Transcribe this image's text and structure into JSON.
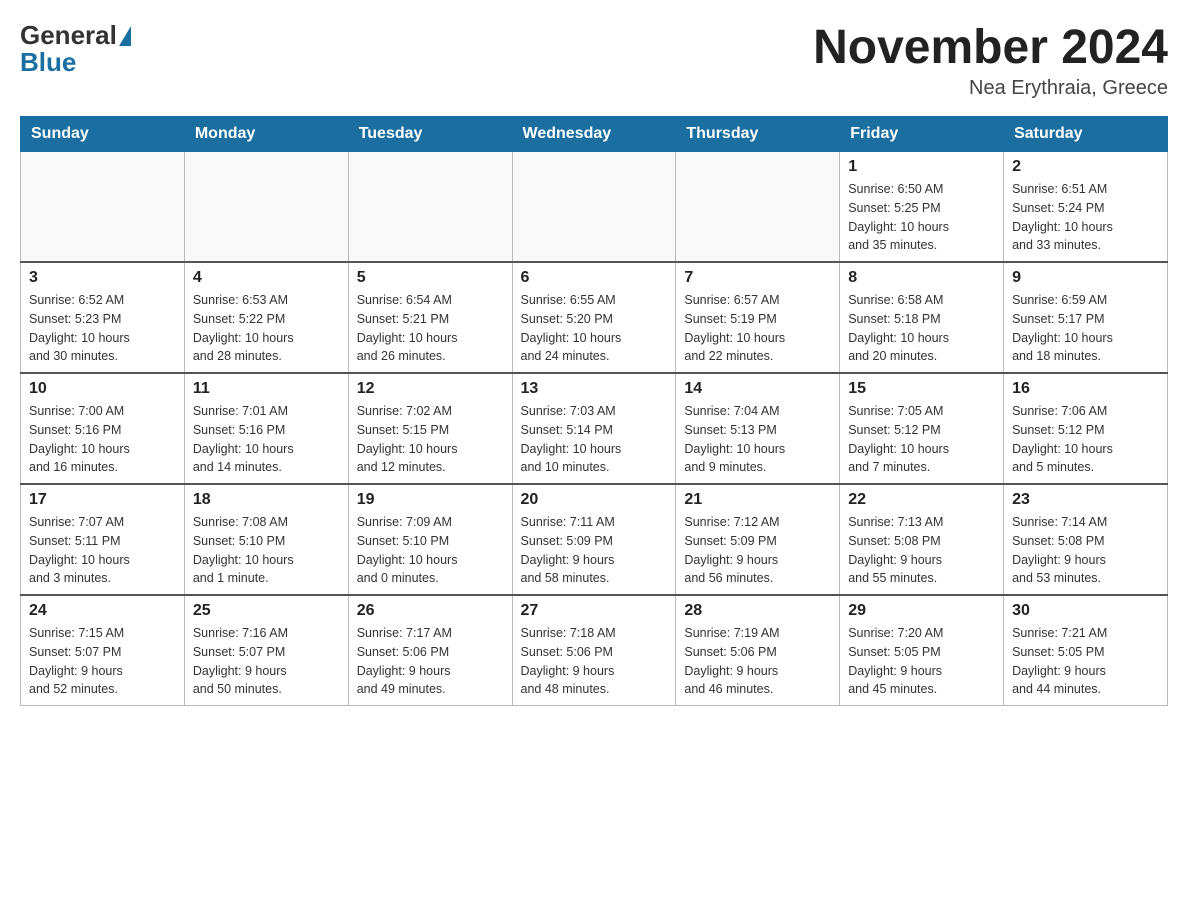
{
  "header": {
    "logo_general": "General",
    "logo_blue": "Blue",
    "title": "November 2024",
    "subtitle": "Nea Erythraia, Greece"
  },
  "days_of_week": [
    "Sunday",
    "Monday",
    "Tuesday",
    "Wednesday",
    "Thursday",
    "Friday",
    "Saturday"
  ],
  "weeks": [
    [
      {
        "day": "",
        "info": ""
      },
      {
        "day": "",
        "info": ""
      },
      {
        "day": "",
        "info": ""
      },
      {
        "day": "",
        "info": ""
      },
      {
        "day": "",
        "info": ""
      },
      {
        "day": "1",
        "info": "Sunrise: 6:50 AM\nSunset: 5:25 PM\nDaylight: 10 hours\nand 35 minutes."
      },
      {
        "day": "2",
        "info": "Sunrise: 6:51 AM\nSunset: 5:24 PM\nDaylight: 10 hours\nand 33 minutes."
      }
    ],
    [
      {
        "day": "3",
        "info": "Sunrise: 6:52 AM\nSunset: 5:23 PM\nDaylight: 10 hours\nand 30 minutes."
      },
      {
        "day": "4",
        "info": "Sunrise: 6:53 AM\nSunset: 5:22 PM\nDaylight: 10 hours\nand 28 minutes."
      },
      {
        "day": "5",
        "info": "Sunrise: 6:54 AM\nSunset: 5:21 PM\nDaylight: 10 hours\nand 26 minutes."
      },
      {
        "day": "6",
        "info": "Sunrise: 6:55 AM\nSunset: 5:20 PM\nDaylight: 10 hours\nand 24 minutes."
      },
      {
        "day": "7",
        "info": "Sunrise: 6:57 AM\nSunset: 5:19 PM\nDaylight: 10 hours\nand 22 minutes."
      },
      {
        "day": "8",
        "info": "Sunrise: 6:58 AM\nSunset: 5:18 PM\nDaylight: 10 hours\nand 20 minutes."
      },
      {
        "day": "9",
        "info": "Sunrise: 6:59 AM\nSunset: 5:17 PM\nDaylight: 10 hours\nand 18 minutes."
      }
    ],
    [
      {
        "day": "10",
        "info": "Sunrise: 7:00 AM\nSunset: 5:16 PM\nDaylight: 10 hours\nand 16 minutes."
      },
      {
        "day": "11",
        "info": "Sunrise: 7:01 AM\nSunset: 5:16 PM\nDaylight: 10 hours\nand 14 minutes."
      },
      {
        "day": "12",
        "info": "Sunrise: 7:02 AM\nSunset: 5:15 PM\nDaylight: 10 hours\nand 12 minutes."
      },
      {
        "day": "13",
        "info": "Sunrise: 7:03 AM\nSunset: 5:14 PM\nDaylight: 10 hours\nand 10 minutes."
      },
      {
        "day": "14",
        "info": "Sunrise: 7:04 AM\nSunset: 5:13 PM\nDaylight: 10 hours\nand 9 minutes."
      },
      {
        "day": "15",
        "info": "Sunrise: 7:05 AM\nSunset: 5:12 PM\nDaylight: 10 hours\nand 7 minutes."
      },
      {
        "day": "16",
        "info": "Sunrise: 7:06 AM\nSunset: 5:12 PM\nDaylight: 10 hours\nand 5 minutes."
      }
    ],
    [
      {
        "day": "17",
        "info": "Sunrise: 7:07 AM\nSunset: 5:11 PM\nDaylight: 10 hours\nand 3 minutes."
      },
      {
        "day": "18",
        "info": "Sunrise: 7:08 AM\nSunset: 5:10 PM\nDaylight: 10 hours\nand 1 minute."
      },
      {
        "day": "19",
        "info": "Sunrise: 7:09 AM\nSunset: 5:10 PM\nDaylight: 10 hours\nand 0 minutes."
      },
      {
        "day": "20",
        "info": "Sunrise: 7:11 AM\nSunset: 5:09 PM\nDaylight: 9 hours\nand 58 minutes."
      },
      {
        "day": "21",
        "info": "Sunrise: 7:12 AM\nSunset: 5:09 PM\nDaylight: 9 hours\nand 56 minutes."
      },
      {
        "day": "22",
        "info": "Sunrise: 7:13 AM\nSunset: 5:08 PM\nDaylight: 9 hours\nand 55 minutes."
      },
      {
        "day": "23",
        "info": "Sunrise: 7:14 AM\nSunset: 5:08 PM\nDaylight: 9 hours\nand 53 minutes."
      }
    ],
    [
      {
        "day": "24",
        "info": "Sunrise: 7:15 AM\nSunset: 5:07 PM\nDaylight: 9 hours\nand 52 minutes."
      },
      {
        "day": "25",
        "info": "Sunrise: 7:16 AM\nSunset: 5:07 PM\nDaylight: 9 hours\nand 50 minutes."
      },
      {
        "day": "26",
        "info": "Sunrise: 7:17 AM\nSunset: 5:06 PM\nDaylight: 9 hours\nand 49 minutes."
      },
      {
        "day": "27",
        "info": "Sunrise: 7:18 AM\nSunset: 5:06 PM\nDaylight: 9 hours\nand 48 minutes."
      },
      {
        "day": "28",
        "info": "Sunrise: 7:19 AM\nSunset: 5:06 PM\nDaylight: 9 hours\nand 46 minutes."
      },
      {
        "day": "29",
        "info": "Sunrise: 7:20 AM\nSunset: 5:05 PM\nDaylight: 9 hours\nand 45 minutes."
      },
      {
        "day": "30",
        "info": "Sunrise: 7:21 AM\nSunset: 5:05 PM\nDaylight: 9 hours\nand 44 minutes."
      }
    ]
  ]
}
